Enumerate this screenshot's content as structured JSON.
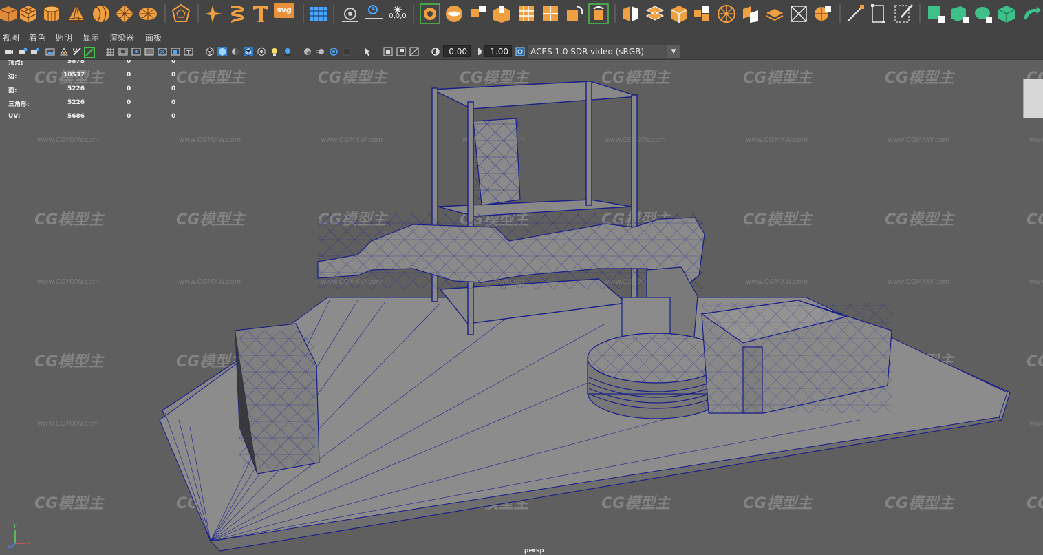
{
  "shelf_icons": [
    "cube-icon",
    "sphere-poly-icon",
    "cylinder-icon",
    "cone-icon",
    "torus-icon",
    "plane-icon",
    "disc-icon",
    "platonic-icon",
    "sparkle-icon",
    "helix-icon",
    "text-icon",
    "svg-icon",
    "grid-icon",
    "sweep-icon",
    "pivot-icon",
    "origin-icon",
    "bridge-icon",
    "extrude-icon",
    "bevel-icon",
    "merge-icon",
    "bool-icon",
    "separate-icon",
    "combine-icon",
    "smooth-icon",
    "mirror-icon",
    "quad-draw-icon",
    "retopo-icon",
    "uv-icon",
    "lasso-icon",
    "paint-icon",
    "sculpt-icon",
    "cut-icon",
    "slice-icon",
    "curve-icon",
    "weight-icon",
    "green-cube-icon",
    "green-box-icon",
    "green-drum-icon",
    "green-stack-icon",
    "green-arrow-icon"
  ],
  "svg_label": "svg",
  "zero_label": "0,0,0",
  "menu": [
    "视图",
    "着色",
    "照明",
    "显示",
    "渲染器",
    "面板"
  ],
  "viewbar": {
    "exposure": "0.00",
    "gamma": "1.00",
    "color_space": "ACES 1.0 SDR-video (sRGB)"
  },
  "hud": {
    "rows": [
      {
        "label": "顶点:",
        "count": "5878",
        "c2": "0",
        "c3": "0"
      },
      {
        "label": "边:",
        "count": "10537",
        "c2": "0",
        "c3": "0"
      },
      {
        "label": "面:",
        "count": "5226",
        "c2": "0",
        "c3": "0"
      },
      {
        "label": "三角形:",
        "count": "5226",
        "c2": "0",
        "c3": "0"
      },
      {
        "label": "UV:",
        "count": "5686",
        "c2": "0",
        "c3": "0"
      }
    ]
  },
  "watermark": {
    "logo": "CG模型主",
    "url": "www.CGMXW.com"
  },
  "camera_label": "persp",
  "axis_labels": {
    "y": "Y",
    "x": "X",
    "z": "Z"
  },
  "colors": {
    "wire": "#1a1f86",
    "shade": "#8a8a8a",
    "accent": "#f0a040",
    "sel_green": "#49c44c"
  }
}
